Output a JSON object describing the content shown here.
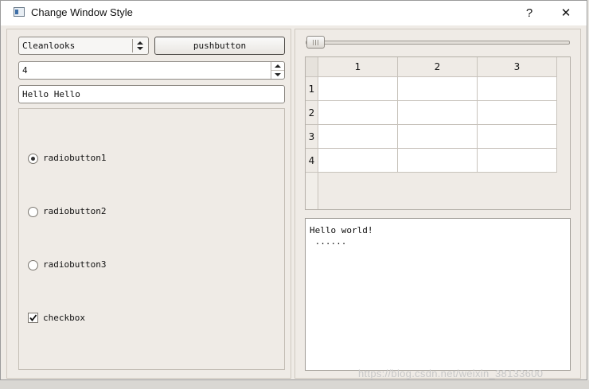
{
  "window": {
    "title": "Change Window Style",
    "help_label": "?",
    "close_label": "✕"
  },
  "left": {
    "style_combo": {
      "value": "Cleanlooks"
    },
    "push_button": {
      "label": "pushbutton"
    },
    "spinbox": {
      "value": "4"
    },
    "line_edit": {
      "value": "Hello Hello"
    },
    "radios": [
      {
        "label": "radiobutton1",
        "checked": true
      },
      {
        "label": "radiobutton2",
        "checked": false
      },
      {
        "label": "radiobutton3",
        "checked": false
      }
    ],
    "checkbox": {
      "label": "checkbox",
      "checked": true
    }
  },
  "right": {
    "slider": {
      "value": 0
    },
    "table": {
      "columns": [
        "1",
        "2",
        "3"
      ],
      "rows": [
        "1",
        "2",
        "3",
        "4"
      ]
    },
    "text_edit": {
      "line1": "Hello world!",
      "line2": " ......"
    }
  },
  "watermark": "https://blog.csdn.net/weixin_38133600"
}
